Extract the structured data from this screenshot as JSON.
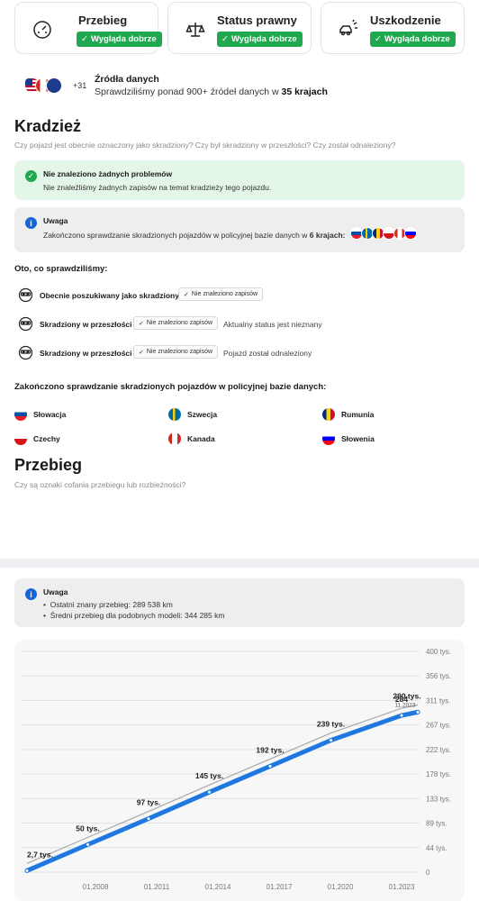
{
  "status_cards": [
    {
      "title": "Przebieg",
      "badge": "Wygląda dobrze",
      "icon": "speedometer-icon"
    },
    {
      "title": "Status prawny",
      "badge": "Wygląda dobrze",
      "icon": "scales-icon"
    },
    {
      "title": "Uszkodzenie",
      "badge": "Wygląda dobrze",
      "icon": "car-crash-icon"
    }
  ],
  "sources": {
    "more": "+31",
    "title": "Źródła danych",
    "text_before": "Sprawdziliśmy ponad 900+ źródeł danych w ",
    "text_bold": "35 krajach"
  },
  "theft": {
    "heading": "Kradzież",
    "question": "Czy pojazd jest obecnie oznaczony jako skradziony? Czy był skradziony w przeszłości? Czy został odnaleziony?",
    "success_title": "Nie znaleziono żadnych problemów",
    "success_text": "Nie znaleźliśmy żadnych zapisów na temat kradzieży tego pojazdu.",
    "note_title": "Uwaga",
    "note_text": "Zakończono sprawdzanie skradzionych pojazdów w policyjnej bazie danych w ",
    "note_bold": "6 krajach:",
    "checked_label": "Oto, co sprawdziliśmy:",
    "checks": [
      {
        "label": "Obecnie poszukiwany jako skradziony",
        "chip": "Nie znaleziono zapisów",
        "extra": ""
      },
      {
        "label": "Skradziony w przeszłości",
        "chip": "Nie znaleziono zapisów",
        "extra": "Aktualny status jest nieznany"
      },
      {
        "label": "Skradziony w przeszłości",
        "chip": "Nie znaleziono zapisów",
        "extra": "Pojazd został odnaleziony"
      }
    ],
    "countries_label": "Zakończono sprawdzanie skradzionych pojazdów w policyjnej bazie danych:",
    "countries": [
      "Słowacja",
      "Szwecja",
      "Rumunia",
      "Czechy",
      "Kanada",
      "Słowenia"
    ]
  },
  "mileage": {
    "heading": "Przebieg",
    "question": "Czy są oznaki cofania przebiegu lub rozbieżności?",
    "note_title": "Uwaga",
    "bullets": [
      "Ostatni znany przebieg: 289 538 km",
      "Średni przebieg dla podobnych modeli: 344 285 km"
    ]
  },
  "colors": {
    "success_bg": "#e4f6e8",
    "success_icon": "#1fa84f",
    "info_bg": "#eeeeee",
    "info_icon": "#1565d8",
    "line_blue": "#1e78e0",
    "avg_line": "#888888"
  },
  "chart_data": {
    "type": "line",
    "x_ticks": [
      "01.2008",
      "01.2011",
      "01.2014",
      "01.2017",
      "01.2020",
      "01.2023"
    ],
    "y_ticks": [
      "0",
      "44 tys.",
      "89 tys.",
      "133 tys.",
      "178 tys.",
      "222 tys.",
      "267 tys.",
      "311 tys.",
      "356 tys.",
      "400 tys."
    ],
    "ylim": [
      0,
      400
    ],
    "series": [
      {
        "values": [
          2.7,
          50,
          97,
          145,
          192,
          239,
          284,
          290
        ]
      }
    ],
    "point_labels": [
      "2,7 tys.",
      "50 tys.",
      "97 tys.",
      "145 tys.",
      "192 tys.",
      "239 tys.",
      "284",
      "290 tys."
    ],
    "last_point_date": "11.2023",
    "grid": true
  }
}
